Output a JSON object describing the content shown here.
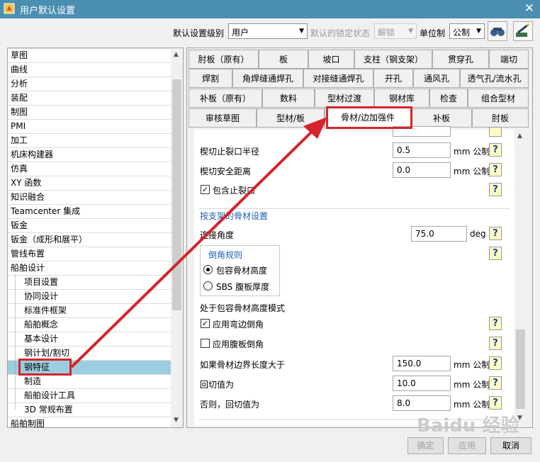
{
  "window": {
    "title": "用户默认设置",
    "close": "✕"
  },
  "top": {
    "level_label": "默认设置级别",
    "level_value": "用户",
    "lock_label": "默认的锁定状态",
    "lock_value": "解锁",
    "unit_label": "单位制",
    "unit_value": "公制"
  },
  "tree": {
    "items": [
      {
        "label": "草图"
      },
      {
        "label": "曲线"
      },
      {
        "label": "分析"
      },
      {
        "label": "装配"
      },
      {
        "label": "制图"
      },
      {
        "label": "PMI"
      },
      {
        "label": "加工"
      },
      {
        "label": "机床构建器"
      },
      {
        "label": "仿真"
      },
      {
        "label": "XY 函数"
      },
      {
        "label": "知识融合"
      },
      {
        "label": "Teamcenter 集成"
      },
      {
        "label": "钣金"
      },
      {
        "label": "钣金（成形和展平）"
      },
      {
        "label": "管线布置"
      },
      {
        "label": "船舶设计"
      },
      {
        "label": "项目设置"
      },
      {
        "label": "协同设计"
      },
      {
        "label": "标准件框架"
      },
      {
        "label": "船舶概念"
      },
      {
        "label": "基本设计"
      },
      {
        "label": "钢计划/割切"
      },
      {
        "label": "钢特征"
      },
      {
        "label": "制造"
      },
      {
        "label": "船舶设计工具"
      },
      {
        "label": "3D 常规布置"
      },
      {
        "label": "船舶制图"
      }
    ]
  },
  "tabs": {
    "row1": [
      "肘板（原有）",
      "板",
      "坡口",
      "支柱（钢支架）",
      "贯穿孔",
      "端切"
    ],
    "row2": [
      "焊割",
      "角焊缝通焊孔",
      "对接缝通焊孔",
      "开孔",
      "通风孔",
      "透气孔/流水孔"
    ],
    "row3": [
      "补板（原有）",
      "数料",
      "型材过渡",
      "钢材库",
      "检查",
      "组合型材"
    ],
    "row4": [
      "审核草图",
      "型材/板",
      "骨材/边加强件",
      "补板",
      "肘板"
    ]
  },
  "content": {
    "cut_relief_label": "楔切止裂口半径",
    "cut_relief_value": "0.5",
    "cut_safe_label": "楔切安全距离",
    "cut_safe_value": "0.0",
    "unit_mm": "mm 公制",
    "include_relief_label": "包含止裂口",
    "section_title": "按支架的骨材设置",
    "connect_angle_label": "连接角度",
    "connect_angle_value": "75.0",
    "unit_deg": "deg",
    "chamfer_group_title": "倒角规则",
    "radio_contain": "包容骨材高度",
    "radio_sbs": "SBS 腹板厚度",
    "mode_label": "处于包容骨材高度模式",
    "apply_bend_label": "应用弯边倒角",
    "apply_web_label": "应用腹板倒角",
    "if_longer_label": "如果骨材边界长度大于",
    "if_longer_value": "150.0",
    "cutback_label": "回切值为",
    "cutback_value": "10.0",
    "else_label": "否则，回切值为",
    "else_value": "8.0",
    "help_glyph": "?"
  },
  "buttons": {
    "ok": "确定",
    "apply": "应用",
    "cancel": "取消"
  },
  "watermark": "Baidu 经验",
  "colors": {
    "titlebar": "#4a8fb1",
    "selected": "#9bcde0",
    "annotation": "#d4252a"
  }
}
